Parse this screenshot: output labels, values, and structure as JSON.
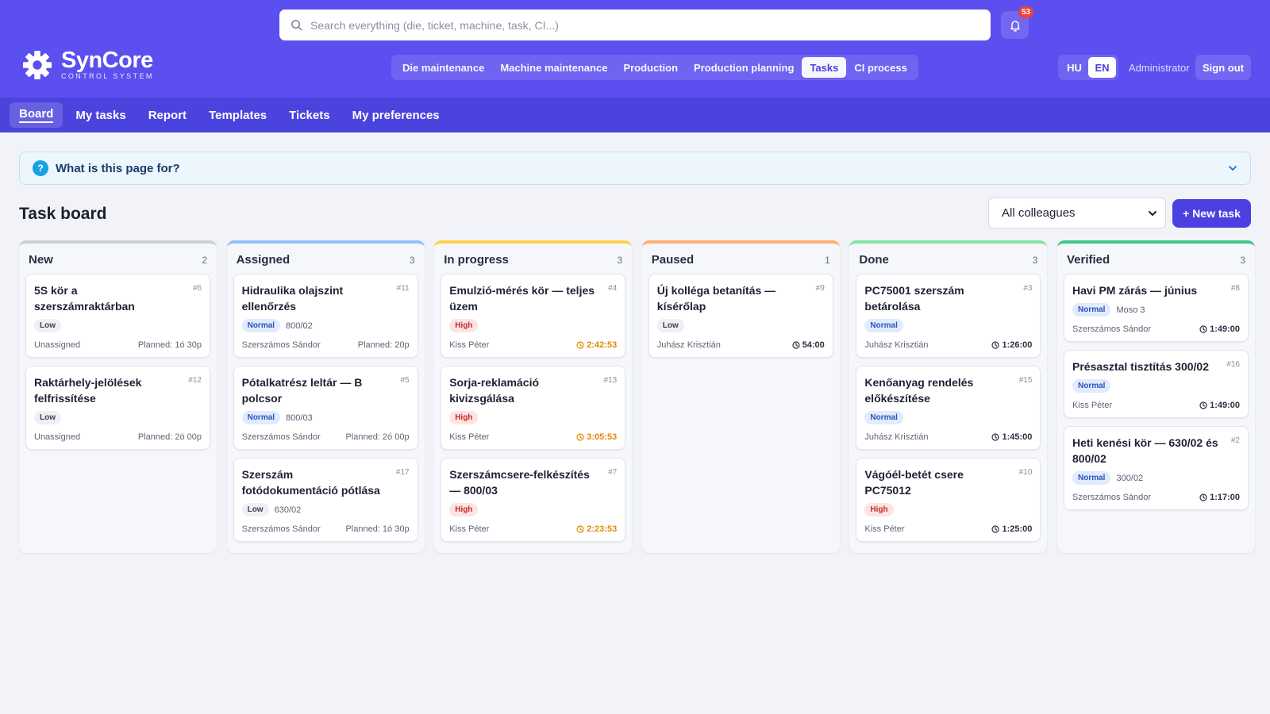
{
  "header": {
    "search_placeholder": "Search everything (die, ticket, machine, task, CI...)",
    "notification_count": "53",
    "logo_title": "SynCore",
    "logo_subtitle": "CONTROL SYSTEM",
    "modules": [
      "Die maintenance",
      "Machine maintenance",
      "Production",
      "Production planning",
      "Tasks",
      "CI process"
    ],
    "active_module": "Tasks",
    "languages": [
      "HU",
      "EN"
    ],
    "active_language": "EN",
    "user": "Administrator",
    "sign_out": "Sign out"
  },
  "subnav": {
    "items": [
      "Board",
      "My tasks",
      "Report",
      "Templates",
      "Tickets",
      "My preferences"
    ],
    "active": "Board"
  },
  "help": {
    "text": "What is this page for?"
  },
  "page": {
    "title": "Task board",
    "filter_value": "All colleagues",
    "new_task_label": "+ New task"
  },
  "colors": {
    "primary": "#5b4ff0",
    "subnav": "#4a43dd",
    "accent": "#4b40e0",
    "running_timer": "#e08a06"
  },
  "columns": [
    {
      "title": "New",
      "count": "2",
      "color": "#cbcfd9",
      "cards": [
        {
          "title": "5S kör a szerszámraktárban",
          "id": "#6",
          "priority": "Low",
          "machine": "",
          "assignee": "Unassigned",
          "right": "Planned: 1ó 30p",
          "type": "planned"
        },
        {
          "title": "Raktárhely-jelölések felfrissítése",
          "id": "#12",
          "priority": "Low",
          "machine": "",
          "assignee": "Unassigned",
          "right": "Planned: 2ó 00p",
          "type": "planned"
        }
      ]
    },
    {
      "title": "Assigned",
      "count": "3",
      "color": "#93c2f8",
      "cards": [
        {
          "title": "Hidraulika olajszint ellenőrzés",
          "id": "#11",
          "priority": "Normal",
          "machine": "800/02",
          "assignee": "Szerszámos Sándor",
          "right": "Planned: 20p",
          "type": "planned"
        },
        {
          "title": "Pótalkatrész leltár — B polcsor",
          "id": "#5",
          "priority": "Normal",
          "machine": "800/03",
          "assignee": "Szerszámos Sándor",
          "right": "Planned: 2ó 00p",
          "type": "planned"
        },
        {
          "title": "Szerszám fotódokumentáció pótlása",
          "id": "#17",
          "priority": "Low",
          "machine": "630/02",
          "assignee": "Szerszámos Sándor",
          "right": "Planned: 1ó 30p",
          "type": "planned"
        }
      ]
    },
    {
      "title": "In progress",
      "count": "3",
      "color": "#fbd24a",
      "cards": [
        {
          "title": "Emulzió-mérés kör — teljes üzem",
          "id": "#4",
          "priority": "High",
          "machine": "",
          "assignee": "Kiss Péter",
          "right": "2:42:53",
          "type": "running"
        },
        {
          "title": "Sorja-reklamáció kivizsgálása",
          "id": "#13",
          "priority": "High",
          "machine": "",
          "assignee": "Kiss Péter",
          "right": "3:05:53",
          "type": "running"
        },
        {
          "title": "Szerszámcsere-felkészítés — 800/03",
          "id": "#7",
          "priority": "High",
          "machine": "",
          "assignee": "Kiss Péter",
          "right": "2:23:53",
          "type": "running"
        }
      ]
    },
    {
      "title": "Paused",
      "count": "1",
      "color": "#fcb071",
      "cards": [
        {
          "title": "Új kolléga betanítás — kísérőlap",
          "id": "#9",
          "priority": "Low",
          "machine": "",
          "assignee": "Juhász Krisztián",
          "right": "54:00",
          "type": "timer"
        }
      ]
    },
    {
      "title": "Done",
      "count": "3",
      "color": "#86e3a2",
      "cards": [
        {
          "title": "PC75001 szerszám betárolása",
          "id": "#3",
          "priority": "Normal",
          "machine": "",
          "assignee": "Juhász Krisztián",
          "right": "1:26:00",
          "type": "timer"
        },
        {
          "title": "Kenőanyag rendelés előkészítése",
          "id": "#15",
          "priority": "Normal",
          "machine": "",
          "assignee": "Juhász Krisztián",
          "right": "1:45:00",
          "type": "timer"
        },
        {
          "title": "Vágóél-betét csere PC75012",
          "id": "#10",
          "priority": "High",
          "machine": "",
          "assignee": "Kiss Péter",
          "right": "1:25:00",
          "type": "timer"
        }
      ]
    },
    {
      "title": "Verified",
      "count": "3",
      "color": "#3ec98a",
      "cards": [
        {
          "title": "Havi PM zárás — június",
          "id": "#8",
          "priority": "Normal",
          "machine": "Moso 3",
          "assignee": "Szerszámos Sándor",
          "right": "1:49:00",
          "type": "timer"
        },
        {
          "title": "Présasztal tisztítás 300/02",
          "id": "#16",
          "priority": "Normal",
          "machine": "",
          "assignee": "Kiss Péter",
          "right": "1:49:00",
          "type": "timer"
        },
        {
          "title": "Heti kenési kör — 630/02 és 800/02",
          "id": "#2",
          "priority": "Normal",
          "machine": "300/02",
          "assignee": "Szerszámos Sándor",
          "right": "1:17:00",
          "type": "timer"
        }
      ]
    }
  ]
}
